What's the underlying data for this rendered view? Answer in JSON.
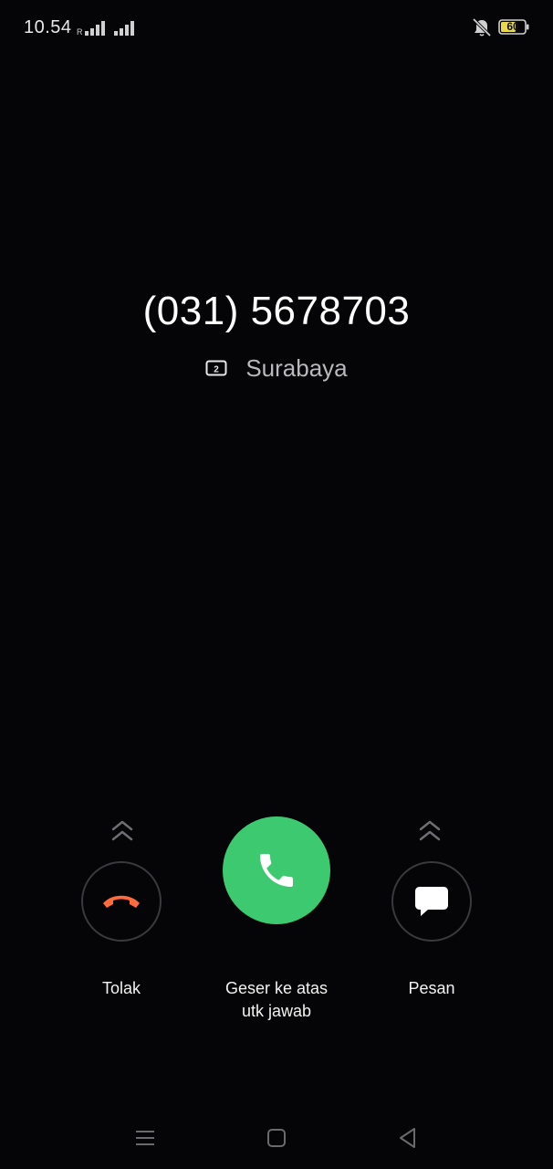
{
  "status_bar": {
    "time": "10.54",
    "signal_1_icon": "signal-roaming-icon",
    "signal_2_icon": "signal-icon",
    "mute_icon": "vibrate-off-icon",
    "battery_level": "60",
    "battery_color": "#e8d84a"
  },
  "call": {
    "number": "(031) 5678703",
    "sim_icon": "sim-2-icon",
    "location": "Surabaya"
  },
  "actions": {
    "decline": {
      "label": "Tolak",
      "icon": "end-call-icon",
      "color": "#ff6b3d"
    },
    "answer": {
      "label_line1": "Geser ke atas",
      "label_line2": "utk jawab",
      "icon": "phone-icon",
      "color": "#3cc96f"
    },
    "message": {
      "label": "Pesan",
      "icon": "message-icon"
    }
  },
  "nav": {
    "menu_icon": "menu-icon",
    "home_icon": "home-icon",
    "back_icon": "back-icon"
  }
}
